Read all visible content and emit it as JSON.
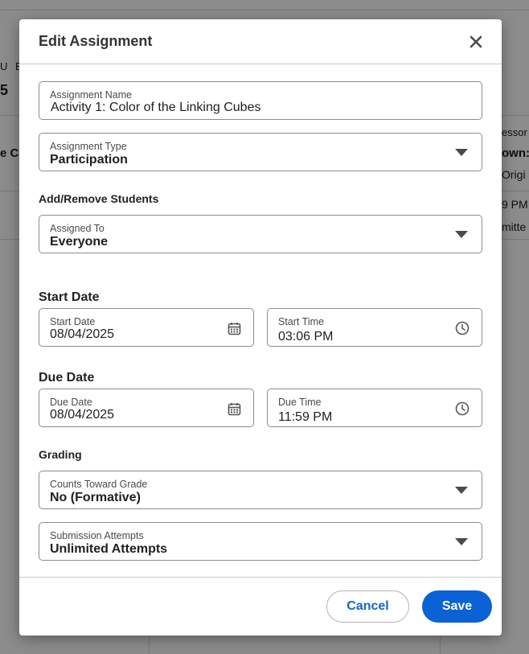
{
  "background": {
    "fragments": [
      "U E",
      "5",
      "e C",
      "essor",
      "own:",
      "Origi",
      "9 PM",
      "mitte"
    ]
  },
  "modal": {
    "title": "Edit Assignment",
    "close_icon": "close-icon"
  },
  "assignment_name": {
    "label": "Assignment Name",
    "value": "Activity 1: Color of the Linking Cubes"
  },
  "assignment_type": {
    "label": "Assignment Type",
    "value": "Participation"
  },
  "students": {
    "section": "Add/Remove Students",
    "label": "Assigned To",
    "value": "Everyone"
  },
  "start": {
    "section": "Start Date",
    "date_label": "Start Date",
    "date_value": "08/04/2025",
    "time_label": "Start Time",
    "time_value": "03:06 PM"
  },
  "due": {
    "section": "Due Date",
    "date_label": "Due Date",
    "date_value": "08/04/2025",
    "time_label": "Due Time",
    "time_value": "11:59 PM"
  },
  "grading": {
    "section": "Grading",
    "counts_label": "Counts Toward Grade",
    "counts_value": "No (Formative)",
    "attempts_label": "Submission Attempts",
    "attempts_value": "Unlimited Attempts"
  },
  "footer": {
    "cancel_label": "Cancel",
    "save_label": "Save"
  },
  "colors": {
    "primary": "#0b62d4",
    "link": "#1565c0"
  }
}
